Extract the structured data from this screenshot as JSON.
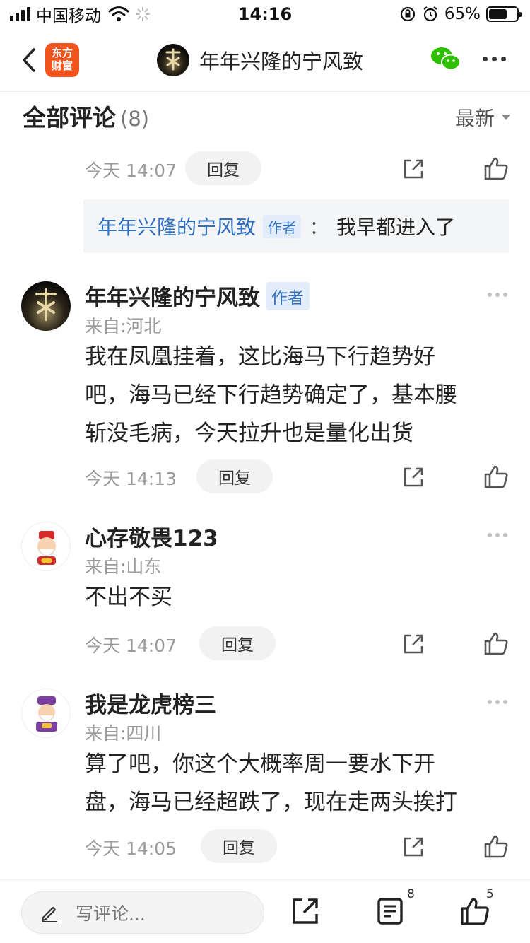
{
  "status_bar": {
    "carrier": "中国移动",
    "time": "14:16",
    "battery": "65%",
    "battery_level": 0.65
  },
  "nav": {
    "app_logo_line1": "东方",
    "app_logo_line2": "财富",
    "title": "年年兴隆的宁风致"
  },
  "section": {
    "title": "全部评论",
    "count": "(8)",
    "sort": "最新"
  },
  "top_reply_row": {
    "time": "今天 14:07",
    "reply": "回复"
  },
  "quote": {
    "name": "年年兴隆的宁风致",
    "tag": "作者",
    "colon": "：",
    "text": "我早都进入了"
  },
  "comments": [
    {
      "name": "年年兴隆的宁风致",
      "tag": "作者",
      "location": "来自:河北",
      "lines": [
        "我在凤凰挂着，这比海马下行趋势好",
        "吧，海马已经下行趋势确定了，基本腰",
        "斩没毛病，今天拉升也是量化出货"
      ],
      "time": "今天 14:13",
      "reply": "回复"
    },
    {
      "name": "心存敬畏123",
      "location": "来自:山东",
      "lines": [
        "不出不买"
      ],
      "time": "今天 14:07",
      "reply": "回复"
    },
    {
      "name": "我是龙虎榜三",
      "location": "来自:四川",
      "lines": [
        "算了吧，你这个大概率周一要水下开",
        "盘，海马已经超跌了，现在走两头挨打"
      ],
      "time": "今天 14:05",
      "reply": "回复"
    }
  ],
  "bottom_bar": {
    "placeholder": "写评论...",
    "comments_count": "8",
    "likes_count": "5"
  },
  "icons": [
    "back-icon",
    "wechat-icon",
    "more-icon",
    "share-icon",
    "like-icon",
    "pencil-icon",
    "comment-list-icon"
  ],
  "colors": {
    "brand": "#f1551d",
    "link_blue": "#2f6fbf",
    "tag_bg": "#e3edf9",
    "wechat_green": "#2dc100"
  }
}
